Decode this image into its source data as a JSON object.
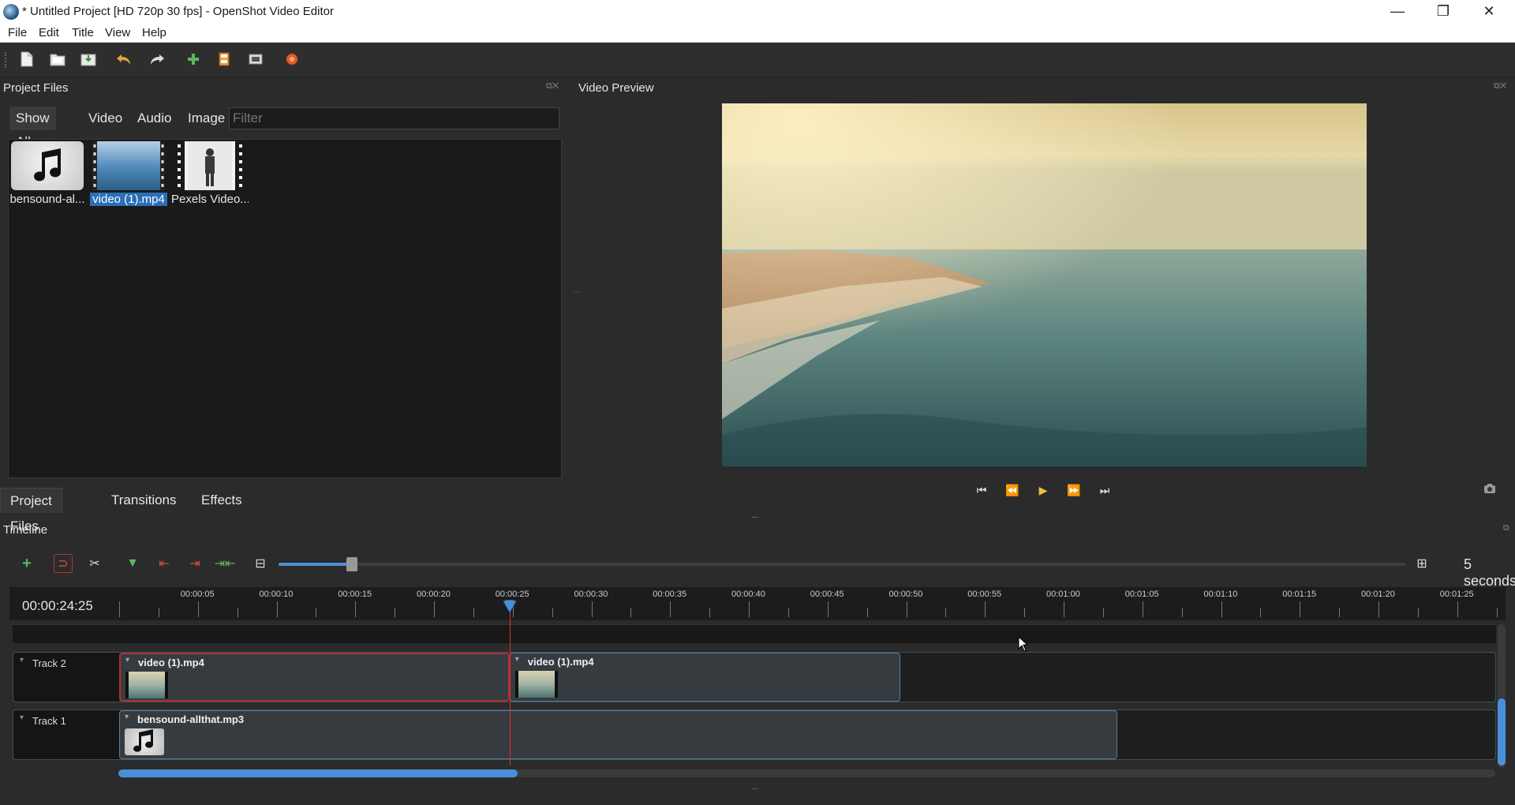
{
  "window": {
    "title": "* Untitled Project [HD 720p 30 fps] - OpenShot Video Editor",
    "min_icon": "—",
    "max_icon": "❐",
    "close_icon": "✕"
  },
  "menu": {
    "file": "File",
    "edit": "Edit",
    "title": "Title",
    "view": "View",
    "help": "Help"
  },
  "project_files": {
    "panel_title": "Project Files",
    "tabs": {
      "show_all": "Show All",
      "video": "Video",
      "audio": "Audio",
      "image": "Image"
    },
    "filter_placeholder": "Filter",
    "files": [
      {
        "name": "bensound-al...",
        "type": "audio",
        "selected": false
      },
      {
        "name": "video (1).mp4",
        "type": "video",
        "selected": true
      },
      {
        "name": "Pexels Video...",
        "type": "video",
        "selected": false
      }
    ]
  },
  "bottom_tabs": {
    "project_files": "Project Files",
    "transitions": "Transitions",
    "effects": "Effects"
  },
  "preview": {
    "panel_title": "Video Preview"
  },
  "timeline": {
    "panel_title": "Timeline",
    "zoom_label": "5 seconds",
    "zoom_fraction": 0.06,
    "timecode": "00:00:24:25",
    "ruler_labels": [
      "00:00:05",
      "00:00:10",
      "00:00:15",
      "00:00:20",
      "00:00:25",
      "00:00:30",
      "00:00:35",
      "00:00:40",
      "00:00:45",
      "00:00:50",
      "00:00:55",
      "00:01:00",
      "00:01:05",
      "00:01:10",
      "00:01:15",
      "00:01:20",
      "00:01:25"
    ],
    "tracks": [
      {
        "name": "Track 2",
        "clips": [
          {
            "name": "video (1).mp4",
            "start_s": 0,
            "end_s": 24.8,
            "selected": true,
            "kind": "video"
          },
          {
            "name": "video (1).mp4",
            "start_s": 24.8,
            "end_s": 49.6,
            "selected": false,
            "kind": "video"
          }
        ]
      },
      {
        "name": "Track 1",
        "clips": [
          {
            "name": "bensound-allthat.mp3",
            "start_s": 0,
            "end_s": 63.4,
            "selected": false,
            "kind": "audio"
          }
        ]
      }
    ],
    "playhead_s": 24.8,
    "h_scroll_fraction": 0.29
  },
  "colors": {
    "accent": "#4a90d9",
    "selection": "#2a6fb8",
    "playhead": "#e03030"
  }
}
